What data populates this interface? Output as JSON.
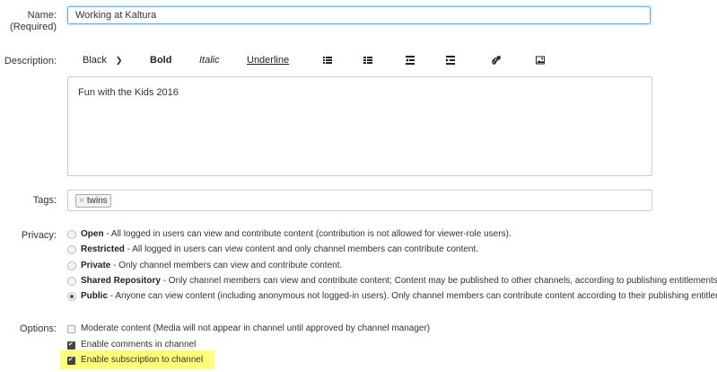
{
  "labels": {
    "name": "Name:",
    "required": "(Required)",
    "description": "Description:",
    "tags": "Tags:",
    "privacy": "Privacy:",
    "options": "Options:"
  },
  "name_value": "Working at Kaltura",
  "toolbar": {
    "color": "Black",
    "bold": "Bold",
    "italic": "Italic",
    "underline": "Underline",
    "icons": [
      "bulleted-list-icon",
      "numbered-list-icon",
      "outdent-icon",
      "indent-icon",
      "link-icon",
      "image-icon"
    ]
  },
  "description_text": "Fun with the Kids 2016",
  "tags": [
    {
      "text": "twins",
      "remove": "×"
    }
  ],
  "privacy": [
    {
      "title": "Open",
      "desc": " - All logged in users can view and contribute content (contribution is not allowed for viewer-role users).",
      "checked": false
    },
    {
      "title": "Restricted",
      "desc": " - All logged in users can view content and only channel members can contribute content.",
      "checked": false
    },
    {
      "title": "Private",
      "desc": " - Only channel members can view and contribute content.",
      "checked": false
    },
    {
      "title": "Shared Repository",
      "desc": " - Only channel members can view and contribute content; Content may be published to other channels, according to publishing entitlements.",
      "checked": false
    },
    {
      "title": "Public",
      "desc": " - Anyone can view content (including anonymous not logged-in users). Only channel members can contribute content according to their publishing entitlements.",
      "checked": true
    }
  ],
  "options": [
    {
      "label": "Moderate content (Media will not appear in channel until approved by channel manager)",
      "checked": false
    },
    {
      "label": "Enable comments in channel",
      "checked": true
    },
    {
      "label": "Enable subscription to channel",
      "checked": true,
      "highlighted": true
    }
  ],
  "colors": {
    "focus_border": "#66afe9",
    "highlight": "#ffff7a"
  }
}
